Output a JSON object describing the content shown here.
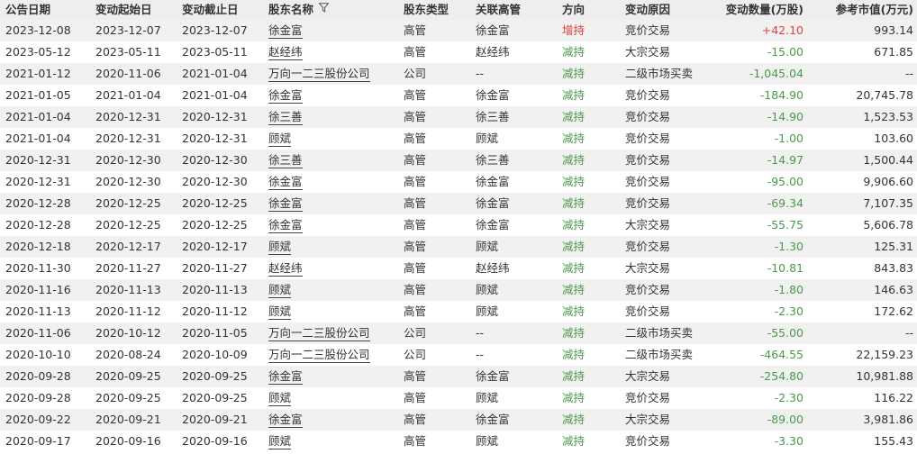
{
  "header": {
    "announce_date": "公告日期",
    "start_date": "变动起始日",
    "end_date": "变动截止日",
    "holder": "股东名称",
    "holder_type": "股东类型",
    "related_exec": "关联高管",
    "direction": "方向",
    "reason": "变动原因",
    "change_qty": "变动数量(万股)",
    "market_value": "参考市值(万元)"
  },
  "filter_icon": "filter-icon",
  "colors": {
    "increase": "#e04040",
    "decrease": "#4b9a4b"
  },
  "rows": [
    {
      "announce": "2023-12-08",
      "start": "2023-12-07",
      "end": "2023-12-07",
      "holder": "徐金富",
      "type": "高管",
      "exec": "徐金富",
      "dir": "增持",
      "reason": "竞价交易",
      "qty": "+42.10",
      "value": "993.14"
    },
    {
      "announce": "2023-05-12",
      "start": "2023-05-11",
      "end": "2023-05-11",
      "holder": "赵经纬",
      "type": "高管",
      "exec": "赵经纬",
      "dir": "减持",
      "reason": "大宗交易",
      "qty": "-15.00",
      "value": "671.85"
    },
    {
      "announce": "2021-01-12",
      "start": "2020-11-06",
      "end": "2021-01-04",
      "holder": "万向一二三股份公司",
      "type": "公司",
      "exec": "--",
      "dir": "减持",
      "reason": "二级市场买卖",
      "qty": "-1,045.04",
      "value": "--"
    },
    {
      "announce": "2021-01-05",
      "start": "2021-01-04",
      "end": "2021-01-04",
      "holder": "徐金富",
      "type": "高管",
      "exec": "徐金富",
      "dir": "减持",
      "reason": "竞价交易",
      "qty": "-184.90",
      "value": "20,745.78"
    },
    {
      "announce": "2021-01-04",
      "start": "2020-12-31",
      "end": "2020-12-31",
      "holder": "徐三善",
      "type": "高管",
      "exec": "徐三善",
      "dir": "减持",
      "reason": "竞价交易",
      "qty": "-14.90",
      "value": "1,523.53"
    },
    {
      "announce": "2021-01-04",
      "start": "2020-12-31",
      "end": "2020-12-31",
      "holder": "顾斌",
      "type": "高管",
      "exec": "顾斌",
      "dir": "减持",
      "reason": "竞价交易",
      "qty": "-1.00",
      "value": "103.60"
    },
    {
      "announce": "2020-12-31",
      "start": "2020-12-30",
      "end": "2020-12-30",
      "holder": "徐三善",
      "type": "高管",
      "exec": "徐三善",
      "dir": "减持",
      "reason": "竞价交易",
      "qty": "-14.97",
      "value": "1,500.44"
    },
    {
      "announce": "2020-12-31",
      "start": "2020-12-30",
      "end": "2020-12-30",
      "holder": "徐金富",
      "type": "高管",
      "exec": "徐金富",
      "dir": "减持",
      "reason": "竞价交易",
      "qty": "-95.00",
      "value": "9,906.60"
    },
    {
      "announce": "2020-12-28",
      "start": "2020-12-25",
      "end": "2020-12-25",
      "holder": "徐金富",
      "type": "高管",
      "exec": "徐金富",
      "dir": "减持",
      "reason": "竞价交易",
      "qty": "-69.34",
      "value": "7,107.35"
    },
    {
      "announce": "2020-12-28",
      "start": "2020-12-25",
      "end": "2020-12-25",
      "holder": "徐金富",
      "type": "高管",
      "exec": "徐金富",
      "dir": "减持",
      "reason": "大宗交易",
      "qty": "-55.75",
      "value": "5,606.78"
    },
    {
      "announce": "2020-12-18",
      "start": "2020-12-17",
      "end": "2020-12-17",
      "holder": "顾斌",
      "type": "高管",
      "exec": "顾斌",
      "dir": "减持",
      "reason": "竞价交易",
      "qty": "-1.30",
      "value": "125.31"
    },
    {
      "announce": "2020-11-30",
      "start": "2020-11-27",
      "end": "2020-11-27",
      "holder": "赵经纬",
      "type": "高管",
      "exec": "赵经纬",
      "dir": "减持",
      "reason": "大宗交易",
      "qty": "-10.81",
      "value": "843.83"
    },
    {
      "announce": "2020-11-16",
      "start": "2020-11-13",
      "end": "2020-11-13",
      "holder": "顾斌",
      "type": "高管",
      "exec": "顾斌",
      "dir": "减持",
      "reason": "竞价交易",
      "qty": "-1.80",
      "value": "146.63"
    },
    {
      "announce": "2020-11-13",
      "start": "2020-11-12",
      "end": "2020-11-12",
      "holder": "顾斌",
      "type": "高管",
      "exec": "顾斌",
      "dir": "减持",
      "reason": "竞价交易",
      "qty": "-2.30",
      "value": "172.62"
    },
    {
      "announce": "2020-11-06",
      "start": "2020-10-12",
      "end": "2020-11-05",
      "holder": "万向一二三股份公司",
      "type": "公司",
      "exec": "--",
      "dir": "减持",
      "reason": "二级市场买卖",
      "qty": "-55.00",
      "value": "--"
    },
    {
      "announce": "2020-10-10",
      "start": "2020-08-24",
      "end": "2020-10-09",
      "holder": "万向一二三股份公司",
      "type": "公司",
      "exec": "--",
      "dir": "减持",
      "reason": "二级市场买卖",
      "qty": "-464.55",
      "value": "22,159.23"
    },
    {
      "announce": "2020-09-28",
      "start": "2020-09-25",
      "end": "2020-09-25",
      "holder": "徐金富",
      "type": "高管",
      "exec": "徐金富",
      "dir": "减持",
      "reason": "大宗交易",
      "qty": "-254.80",
      "value": "10,981.88"
    },
    {
      "announce": "2020-09-28",
      "start": "2020-09-25",
      "end": "2020-09-25",
      "holder": "顾斌",
      "type": "高管",
      "exec": "顾斌",
      "dir": "减持",
      "reason": "竞价交易",
      "qty": "-2.30",
      "value": "116.22"
    },
    {
      "announce": "2020-09-22",
      "start": "2020-09-21",
      "end": "2020-09-21",
      "holder": "徐金富",
      "type": "高管",
      "exec": "徐金富",
      "dir": "减持",
      "reason": "大宗交易",
      "qty": "-89.00",
      "value": "3,981.86"
    },
    {
      "announce": "2020-09-17",
      "start": "2020-09-16",
      "end": "2020-09-16",
      "holder": "顾斌",
      "type": "高管",
      "exec": "顾斌",
      "dir": "减持",
      "reason": "竞价交易",
      "qty": "-3.30",
      "value": "155.43"
    }
  ]
}
